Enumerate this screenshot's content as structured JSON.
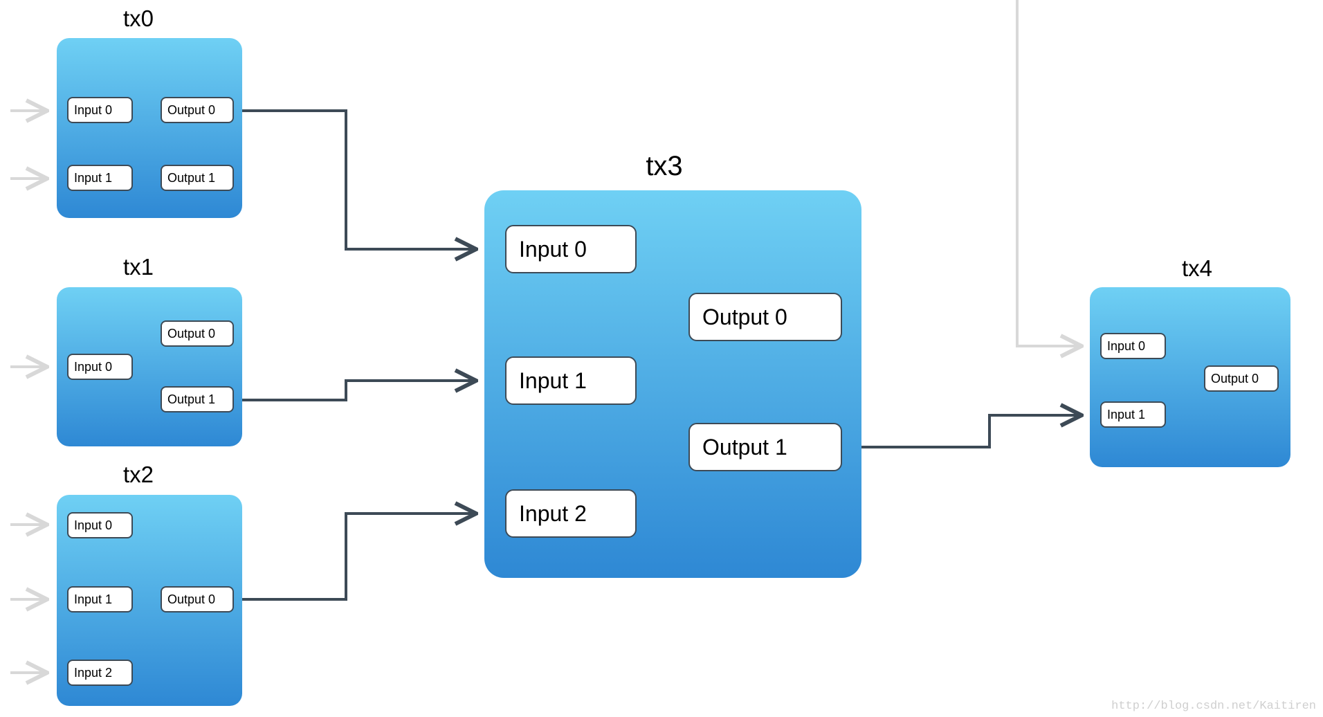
{
  "watermark": "http://blog.csdn.net/Kaitiren",
  "tx0": {
    "title": "tx0",
    "in0": "Input 0",
    "in1": "Input 1",
    "out0": "Output 0",
    "out1": "Output 1"
  },
  "tx1": {
    "title": "tx1",
    "in0": "Input 0",
    "out0": "Output 0",
    "out1": "Output 1"
  },
  "tx2": {
    "title": "tx2",
    "in0": "Input 0",
    "in1": "Input 1",
    "in2": "Input 2",
    "out0": "Output 0"
  },
  "tx3": {
    "title": "tx3",
    "in0": "Input 0",
    "in1": "Input 1",
    "in2": "Input 2",
    "out0": "Output 0",
    "out1": "Output 1"
  },
  "tx4": {
    "title": "tx4",
    "in0": "Input 0",
    "in1": "Input 1",
    "out0": "Output 0"
  }
}
